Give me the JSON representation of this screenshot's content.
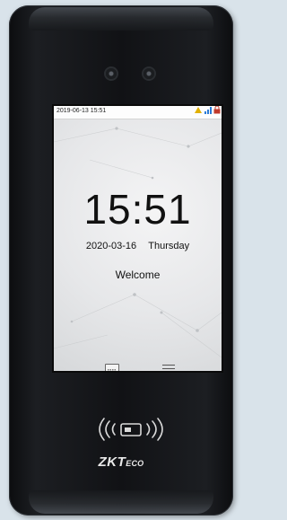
{
  "status_bar": {
    "datetime": "2019-06-13 15:51",
    "icons": [
      "warning-icon",
      "network-icon",
      "lock-icon"
    ]
  },
  "clock": {
    "time": "15:51",
    "date": "2020-03-16",
    "weekday": "Thursday"
  },
  "message": "Welcome",
  "bottom_icons": [
    "keyboard-icon",
    "menu-icon"
  ],
  "reader": {
    "icon": "nfc-card-reader-icon"
  },
  "brand": {
    "logo_main": "ZKT",
    "logo_suffix": "ECO"
  },
  "colors": {
    "device_body": "#111215",
    "screen_bg": "#e6e7e9",
    "warning": "#e1b000"
  }
}
